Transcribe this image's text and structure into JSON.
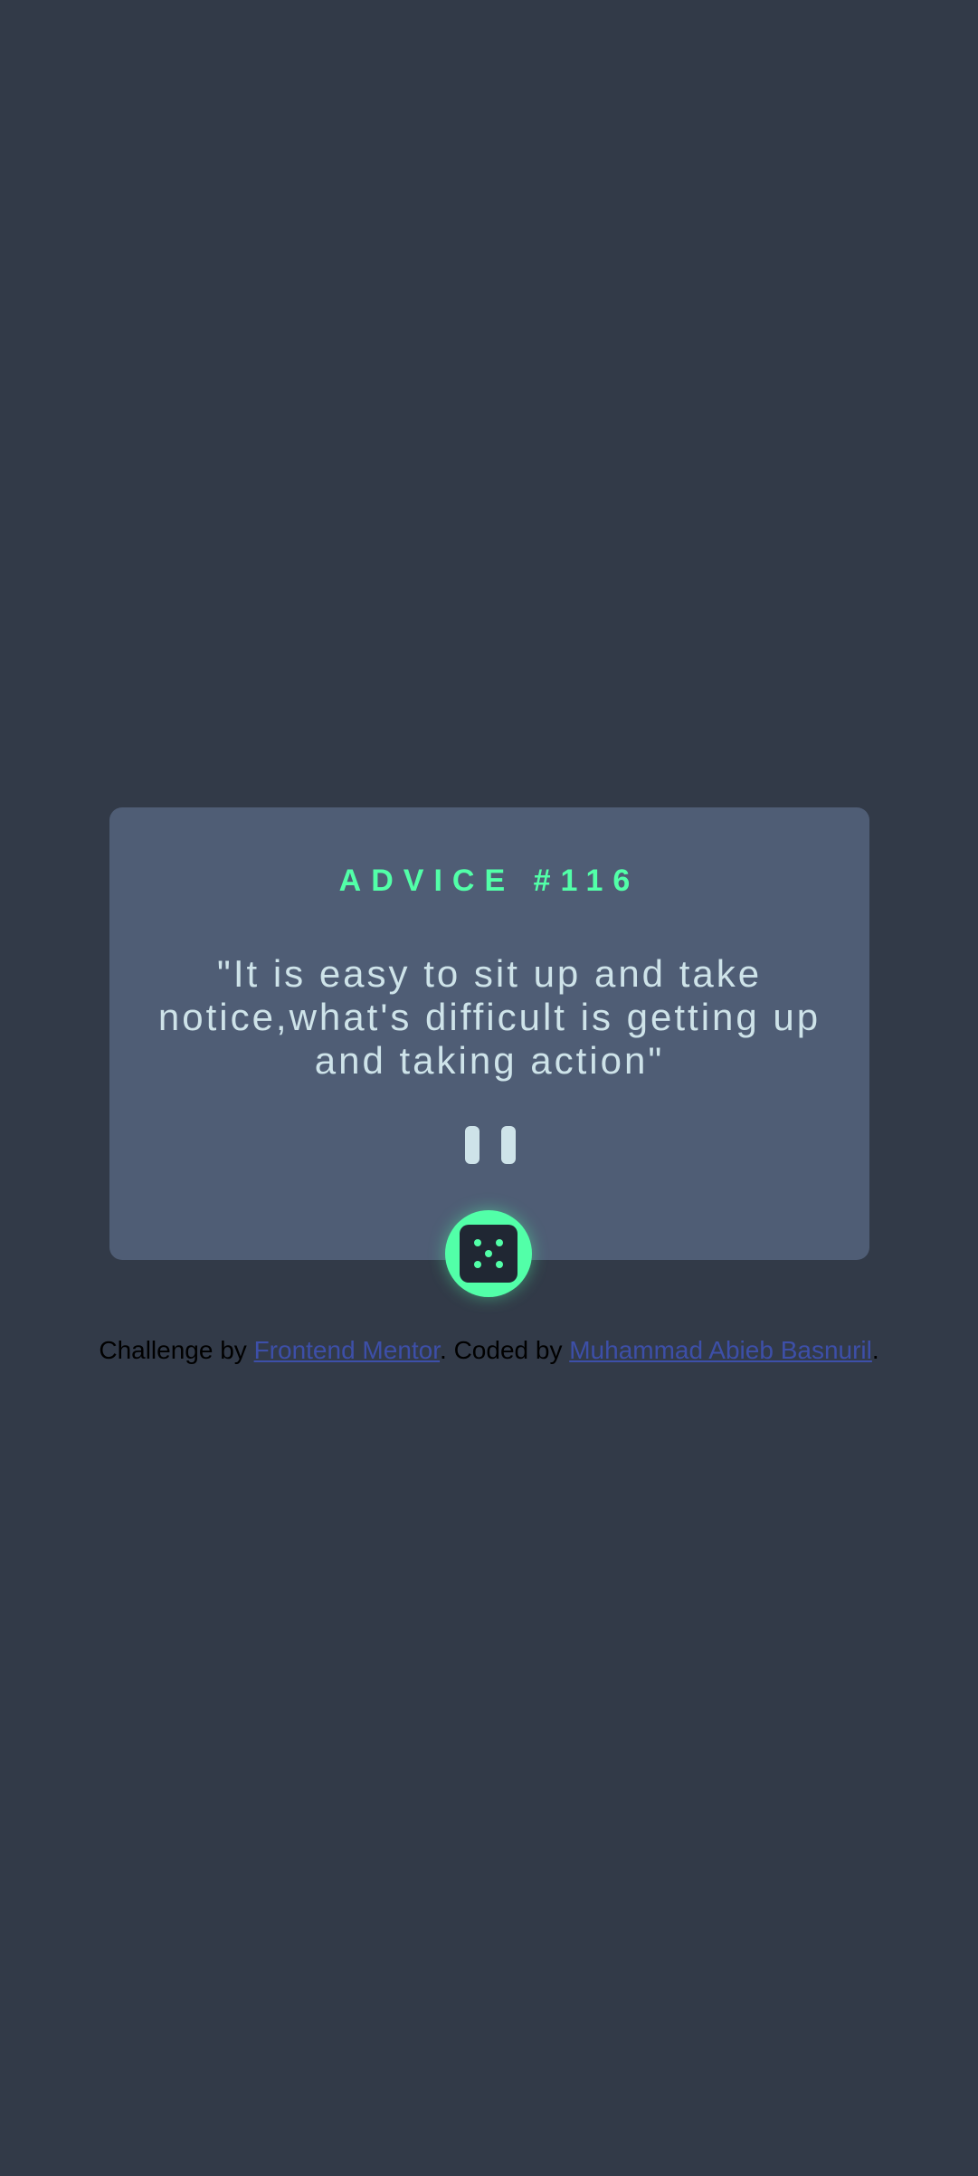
{
  "advice": {
    "label": "ADVICE #116",
    "quote": "\"It is easy to sit up and take notice,what's difficult is getting up and taking action\""
  },
  "dice_button": {
    "icon": "dice-icon"
  },
  "footer": {
    "prefix": "Challenge by ",
    "link1": "Frontend Mentor",
    "middle": ". Coded by ",
    "link2": "Muhammad Abieb Basnuril",
    "suffix": "."
  },
  "colors": {
    "background": "#323a48",
    "card": "#4f5d75",
    "accent": "#52ffa8",
    "text": "#cee3e9",
    "link": "#3d4fa8"
  }
}
